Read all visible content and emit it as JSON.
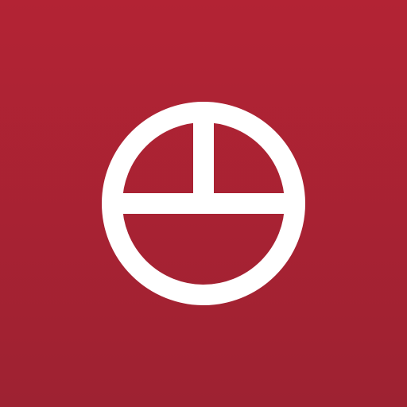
{
  "app_icon": {
    "icon_name": "circle-quadrant-logo-icon",
    "colors": {
      "background_top": "#B32334",
      "background_bottom": "#9E2232",
      "mark": "#FFFFFF"
    }
  }
}
